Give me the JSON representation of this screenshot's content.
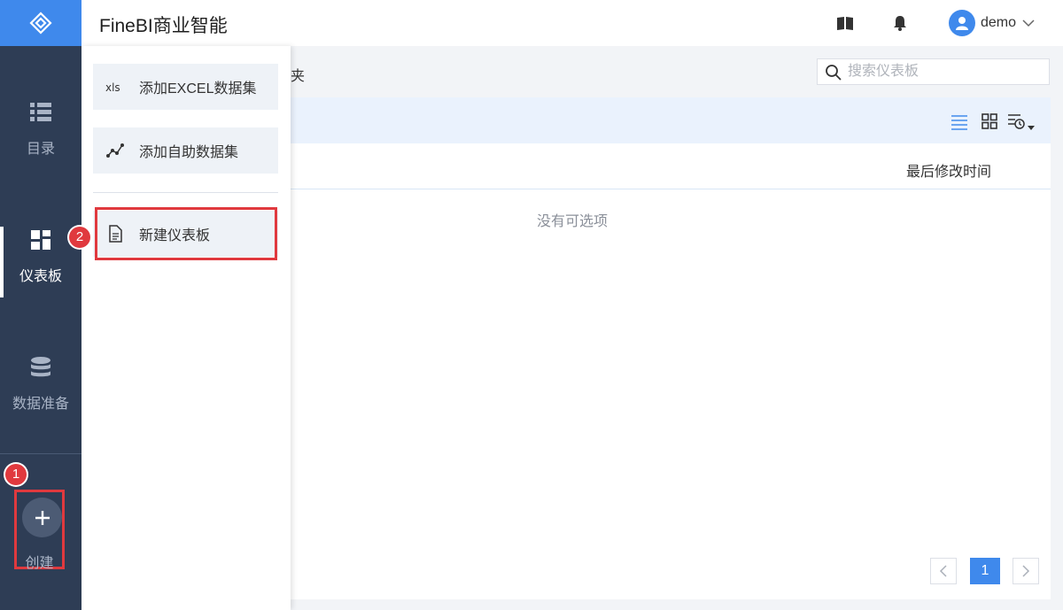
{
  "app": {
    "title": "FineBI商业智能"
  },
  "sidebar": {
    "items": [
      {
        "label": "目录",
        "icon": "list-icon"
      },
      {
        "label": "仪表板",
        "icon": "dashboard-icon",
        "active": true
      },
      {
        "label": "数据准备",
        "icon": "database-icon"
      }
    ],
    "create": {
      "label": "创建",
      "icon": "plus-icon"
    }
  },
  "header": {
    "user": {
      "name": "demo"
    }
  },
  "main": {
    "breadcrumb_tail": "夹",
    "search": {
      "placeholder": "搜索仪表板",
      "value": ""
    },
    "table": {
      "columns": [
        "最后修改时间"
      ],
      "empty_text": "没有可选项"
    },
    "pagination": {
      "current": "1"
    }
  },
  "create_menu": {
    "items": [
      {
        "label": "添加EXCEL数据集",
        "icon": "xls-icon"
      },
      {
        "label": "添加自助数据集",
        "icon": "self-service-dataset-icon"
      },
      {
        "label": "新建仪表板",
        "icon": "document-icon"
      }
    ]
  },
  "annotations": {
    "step1": "1",
    "step2": "2"
  },
  "colors": {
    "accent": "#3f89ec",
    "sidebar_bg": "#2e3d55",
    "highlight": "#e0393e",
    "toolbar_bg": "#eaf2fd"
  }
}
